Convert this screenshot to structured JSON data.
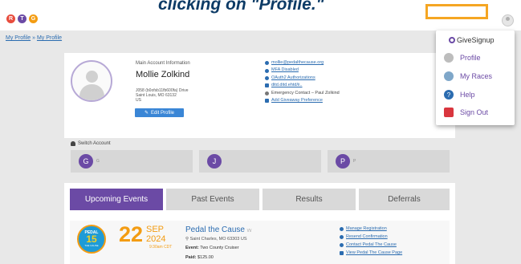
{
  "header": {
    "logo_letters": [
      "R",
      "T",
      "G"
    ],
    "logo_colors": [
      "#e84c3d",
      "#6b4aa5",
      "#f39c12"
    ],
    "instruction": "clicking on \"Profile.\""
  },
  "breadcrumb": [
    "My Profile",
    "»",
    "My Profile"
  ],
  "account": {
    "section_label": "Main Account Information",
    "name": "Mollie Zolkind",
    "address_lines": [
      "J058 (b0ofsb11fb600fa) Drive",
      "Saint Louis, MO 63132",
      "US"
    ],
    "edit_label": "Edit Profile"
  },
  "account_links": [
    {
      "icon": "email-icon",
      "text": "mollie@pedalthecause.org",
      "link": true
    },
    {
      "icon": "shield-icon",
      "text": "MFA Disabled",
      "link": true
    },
    {
      "icon": "key-icon",
      "text": "OAuth2 Authorizations",
      "link": true
    },
    {
      "icon": "phone-icon",
      "text": "ditd.ditd.ehtd/ii..",
      "link": true
    },
    {
      "icon": "emergency-icon",
      "text": "Emergency Contact – Paul Zolkind",
      "link": false
    },
    {
      "icon": "gift-icon",
      "text": "Add Giveaway Preference",
      "link": true
    }
  ],
  "switch_account": {
    "label": "Switch Account",
    "accounts": [
      {
        "initial": "G",
        "name": "G"
      },
      {
        "initial": "J",
        "name": ""
      },
      {
        "initial": "P",
        "name": "P"
      }
    ]
  },
  "tabs": [
    {
      "label": "Upcoming Events",
      "active": true
    },
    {
      "label": "Past Events",
      "active": false
    },
    {
      "label": "Results",
      "active": false
    },
    {
      "label": "Deferrals",
      "active": false
    }
  ],
  "event": {
    "badge_top": "PEDAL",
    "badge_mid": "15",
    "badge_bottom": "THE CAUSE",
    "day": "22",
    "month": "SEP",
    "year": "2024",
    "time": "9:30am CDT",
    "title": "Pedal the Cause",
    "title_tag": "\\/\\/",
    "location": "Saint Charles, MO 63303 US",
    "event_label": "Event:",
    "event_value": "Two County Cruiser",
    "paid_label": "Paid:",
    "paid_value": "$125.00",
    "links": [
      {
        "icon": "gear-icon",
        "text": "Manage Registration"
      },
      {
        "icon": "share-icon",
        "text": "Resend Confirmation"
      },
      {
        "icon": "email-icon",
        "text": "Contact Pedal The Cause"
      },
      {
        "icon": "flag-icon",
        "text": "View Pedal The Cause Page"
      }
    ]
  },
  "dropdown": {
    "brand": "GiveSignup",
    "items": [
      {
        "icon": "user-icon",
        "label": "Profile",
        "color": "#bdbdbd"
      },
      {
        "icon": "race-photo-icon",
        "label": "My Races",
        "color": "#7fa7c9"
      },
      {
        "icon": "help-icon",
        "label": "Help",
        "color": "#2b6cb0"
      },
      {
        "icon": "sign-out-icon",
        "label": "Sign Out",
        "color": "#d9363e"
      }
    ]
  }
}
